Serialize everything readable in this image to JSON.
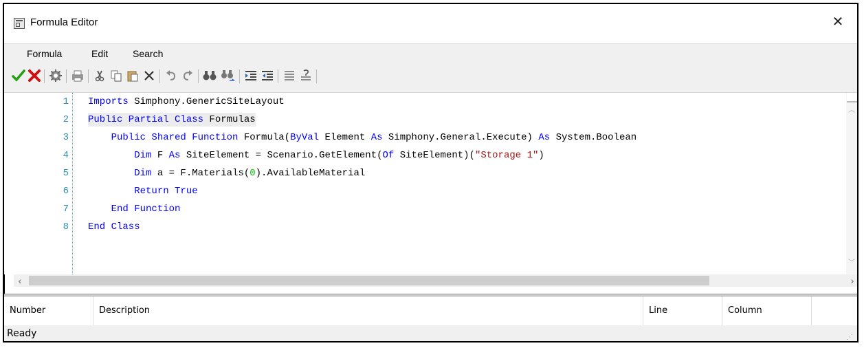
{
  "window": {
    "title": "Formula Editor"
  },
  "menu": {
    "items": [
      "Formula",
      "Edit",
      "Search"
    ]
  },
  "toolbar": {
    "buttons": [
      "accept-icon",
      "cancel-icon",
      "compile-icon",
      "print-icon",
      "cut-icon",
      "copy-icon",
      "paste-icon",
      "delete-icon",
      "undo-icon",
      "redo-icon",
      "find-icon",
      "find-next-icon",
      "indent-icon",
      "outdent-icon",
      "comment-icon",
      "uncomment-icon"
    ],
    "colors": {
      "accept": "#22a010",
      "cancel": "#d01010"
    }
  },
  "editor": {
    "line_numbers": [
      "1",
      "2",
      "3",
      "4",
      "5",
      "6",
      "7",
      "8"
    ],
    "lines": [
      [
        {
          "t": "Imports",
          "c": "kw"
        },
        {
          "t": " Simphony.GenericSiteLayout",
          "c": ""
        }
      ],
      [
        {
          "t": "Public Partial Class",
          "c": "kw"
        },
        {
          "t": " Formulas",
          "c": ""
        }
      ],
      [
        {
          "t": "    Public Shared Function",
          "c": "kw"
        },
        {
          "t": " Formula(",
          "c": ""
        },
        {
          "t": "ByVal",
          "c": "kw"
        },
        {
          "t": " Element ",
          "c": ""
        },
        {
          "t": "As",
          "c": "kw"
        },
        {
          "t": " Simphony.General.Execute) ",
          "c": ""
        },
        {
          "t": "As",
          "c": "kw"
        },
        {
          "t": " System.Boolean",
          "c": ""
        }
      ],
      [
        {
          "t": "        Dim",
          "c": "kw"
        },
        {
          "t": " F ",
          "c": ""
        },
        {
          "t": "As",
          "c": "kw"
        },
        {
          "t": " SiteElement = Scenario.GetElement(",
          "c": ""
        },
        {
          "t": "Of",
          "c": "kw"
        },
        {
          "t": " SiteElement)(",
          "c": ""
        },
        {
          "t": "\"Storage 1\"",
          "c": "str"
        },
        {
          "t": ")",
          "c": ""
        }
      ],
      [
        {
          "t": "        Dim",
          "c": "kw"
        },
        {
          "t": " a = F.Materials(",
          "c": ""
        },
        {
          "t": "0",
          "c": "num"
        },
        {
          "t": ").AvailableMaterial",
          "c": ""
        }
      ],
      [
        {
          "t": "        Return True",
          "c": "kw"
        }
      ],
      [
        {
          "t": "    End Function",
          "c": "kw"
        }
      ],
      [
        {
          "t": "End Class",
          "c": "kw"
        }
      ]
    ]
  },
  "errors": {
    "columns": [
      "Number",
      "Description",
      "Line",
      "Column"
    ],
    "rows": []
  },
  "status": {
    "text": "Ready"
  }
}
